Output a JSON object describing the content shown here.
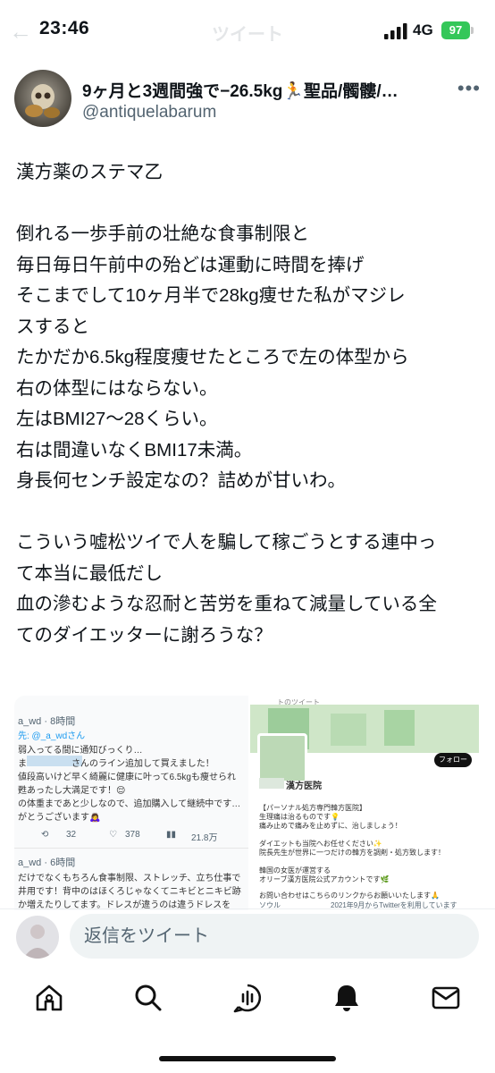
{
  "status": {
    "time": "23:46",
    "network": "4G",
    "battery": "97"
  },
  "nav": {
    "title": "ツイート"
  },
  "author": {
    "name": "9ヶ月と3週間強で−26.5kg🏃聖品/髑髏/…",
    "handle": "@antiquelabarum"
  },
  "tweet": {
    "lines": [
      "漢方薬のステマ乙",
      "",
      "倒れる一歩手前の壮絶な食事制限と",
      "毎日毎日午前中の殆どは運動に時間を捧げ",
      "そこまでして10ヶ月半で28kg痩せた私がマジレ",
      "スすると",
      "たかだか6.5kg程度痩せたところで左の体型から",
      "右の体型にはならない。",
      "左はBMI27〜28くらい。",
      "右は間違いなくBMI17未満。",
      "身長何センチ設定なの？詰めが甘いわ。",
      "",
      "こういう嘘松ツイで人を騙して稼ごうとする連中っ",
      "て本当に最低だし",
      "血の滲むような忍耐と苦労を重ねて減量している全",
      "てのダイエッターに謝ろうな？"
    ]
  },
  "media": {
    "left": {
      "header": "a_wd · 8時間",
      "reply_to": "先: @_a_wdさん",
      "lines": [
        "弱入ってる間に通知びっくり…",
        "ま　　　　　さんのライン追加して買えました！",
        "値段高いけど早く綺麗に健康に叶って6.5kgも痩せられ",
        "甦あったし大満足です！😌",
        "の体重まであと少しなので、追加購入して継続中です…",
        "がとうございます🙇‍♀️"
      ],
      "counts": {
        "retweets": "32",
        "likes": "378",
        "views": "21.8万"
      },
      "header2": "a_wd · 6時間",
      "lines2": [
        "だけでなくもちろん食事制限、ストレッチ、立ち仕事で",
        "井用です！背中のはほくろじゃなくてニキビとニキビ跡",
        "か増えたりしてます。ドレスが違うのは違うドレスを"
      ]
    },
    "right": {
      "top_label": "トのツイート",
      "follow": "フォロー",
      "name": "漢方医院",
      "bio": [
        "【パーソナル処方専門韓方医院】",
        "生理痛は治るものです💡",
        "痛み止めで痛みを止めずに、治しましょう！",
        "",
        "ダイエットも当院へお任せください✨",
        "院長先生が世界に一つだけの韓方を調剤・処方致します！",
        "",
        "韓国の女医が運営する",
        "オリーブ漢方医院公式アカウントです🌿",
        "",
        "お問い合わせはこちらのリンクからお願いいたします🙏"
      ],
      "footer": "ソウル　　　　　　　2021年9月からTwitterを利用しています"
    }
  },
  "reply": {
    "placeholder": "返信をツイート"
  },
  "tabs": [
    "home-icon",
    "search-icon",
    "spaces-icon",
    "notifications-icon",
    "messages-icon"
  ]
}
